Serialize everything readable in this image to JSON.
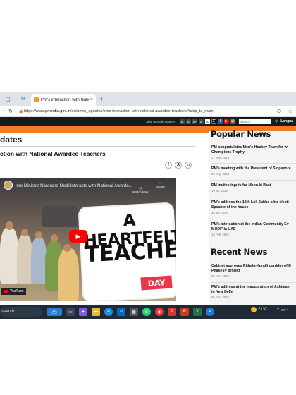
{
  "browser": {
    "tab_title": "PM's interaction with National Aw...",
    "tab_close": "×",
    "new_tab": "+",
    "url_prefix": "https://",
    "url_domain": "www.pmindia.gov.in",
    "url_path": "/en/news_updates/pms-interaction-with-national-awardee-teachers/#skip_to_main"
  },
  "site_strip": {
    "skip_label": "Skip to main content",
    "font_buttons": [
      "A-",
      "A",
      "A+",
      "A",
      "A"
    ],
    "search_placeholder": "Search",
    "language": "Langua"
  },
  "main": {
    "section_heading": "dates",
    "article_title": "ction with National Awardee Teachers",
    "share_icons": [
      "f",
      "X",
      "in"
    ]
  },
  "video": {
    "title": "ime Minister Narendra Modi Interacts with National Awarde...",
    "watch_later": "Watch later",
    "share": "Share",
    "overlay_line1": "A HEARTFELT",
    "overlay_line2": "TEACHERS",
    "overlay_day": "DAY",
    "youtube_label": "YouTube"
  },
  "popular_news": {
    "heading": "Popular News",
    "items": [
      {
        "title": "PM congratulates Men's Hockey Team for wi",
        "title2": "Champions Trophy",
        "date": "17 Sep, 2024"
      },
      {
        "title": "PM's meeting with the President of Singapore",
        "title2": "",
        "date": "05 Sep, 2024"
      },
      {
        "title": "PM invites inputs for Mann ki Baat",
        "title2": "",
        "date": "19 Jul, 2024"
      },
      {
        "title": "PM's address the 18th Lok Sabha after electi",
        "title2": "Speaker of the house",
        "date": "26 Jun, 2024"
      },
      {
        "title": "PM's interaction at the Indian Community Ev",
        "title2": "MODI\" in UAE",
        "date": "13 Feb, 2024"
      }
    ]
  },
  "recent_news": {
    "heading": "Recent News",
    "items": [
      {
        "title": "Cabinet approves Rithala-Kundli corridor of D",
        "title2": "Phase-IV project",
        "date": "06 Dec, 2024"
      },
      {
        "title": "PM's address at the inauguration of Ashtalak",
        "title2": "in New Delhi",
        "date": "06 Dec, 2024"
      }
    ]
  },
  "taskbar": {
    "search_label": "search",
    "temperature": "21°C"
  },
  "colors": {
    "orange_band": "#f47c20",
    "top_strip": "#1a1a1a",
    "taskbar": "#1f2a36",
    "youtube_red": "#ff0000",
    "day_tag": "#e8374d"
  }
}
